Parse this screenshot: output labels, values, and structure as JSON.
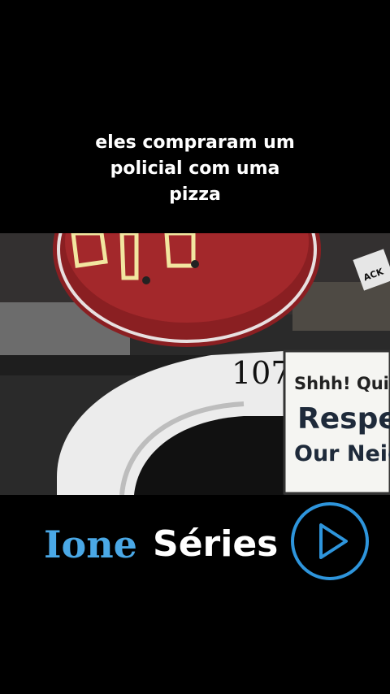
{
  "caption": {
    "lines": [
      "eles compraram um",
      "policial com uma",
      "pizza"
    ]
  },
  "video": {
    "house_number": "107",
    "sign_line_1": "Shhh! Quiet P",
    "sign_line_2": "Respe",
    "sign_line_3": "Our Neighb",
    "corner_label": "ACK"
  },
  "brand": {
    "word_1": "Ione",
    "word_2": "Séries",
    "accent_color": "#4aa8e6",
    "play_icon": "play-icon"
  }
}
